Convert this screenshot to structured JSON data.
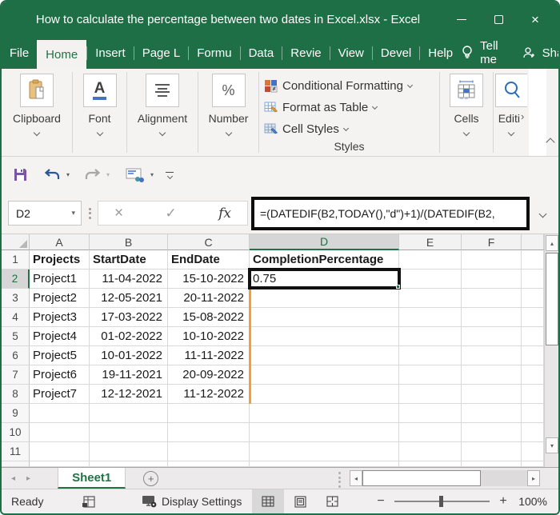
{
  "titlebar": {
    "title": "How to calculate the percentage between two dates in Excel.xlsx - Excel"
  },
  "menu": {
    "tabs": [
      {
        "label": "File",
        "active": false,
        "sep": false
      },
      {
        "label": "Home",
        "active": true,
        "sep": false
      },
      {
        "label": "Insert",
        "active": false,
        "sep": true
      },
      {
        "label": "Page L",
        "active": false,
        "sep": true
      },
      {
        "label": "Formu",
        "active": false,
        "sep": true
      },
      {
        "label": "Data",
        "active": false,
        "sep": true
      },
      {
        "label": "Revie",
        "active": false,
        "sep": true
      },
      {
        "label": "View",
        "active": false,
        "sep": true
      },
      {
        "label": "Devel",
        "active": false,
        "sep": true
      },
      {
        "label": "Help",
        "active": false,
        "sep": true
      }
    ],
    "tell_me": "Tell me",
    "share": "Share"
  },
  "ribbon": {
    "groups": [
      {
        "label": "Clipboard"
      },
      {
        "label": "Font"
      },
      {
        "label": "Alignment"
      },
      {
        "label": "Number"
      }
    ],
    "styles": {
      "items": [
        "Conditional Formatting",
        "Format as Table",
        "Cell Styles"
      ],
      "label": "Styles"
    },
    "cells": {
      "label": "Cells"
    },
    "editing": {
      "label": "Editi",
      "more_glyph": "›"
    }
  },
  "formula_bar": {
    "name_box": "D2",
    "cancel_glyph": "×",
    "enter_glyph": "✓",
    "fx_glyph": "fx",
    "formula": "=(DATEDIF(B2,TODAY(),\"d\")+1)/(DATEDIF(B2,"
  },
  "grid": {
    "column_headers": [
      "A",
      "B",
      "C",
      "D",
      "E",
      "F"
    ],
    "selected_column": "D",
    "selected_cell": "D2",
    "selected_row": 2,
    "rows": [
      {
        "n": 1,
        "cells": [
          "Projects",
          "StartDate",
          "EndDate",
          "CompletionPercentage"
        ],
        "header": true
      },
      {
        "n": 2,
        "cells": [
          "Project1",
          "11-04-2022",
          "15-10-2022",
          "0.75"
        ]
      },
      {
        "n": 3,
        "cells": [
          "Project2",
          "12-05-2021",
          "20-11-2022",
          ""
        ]
      },
      {
        "n": 4,
        "cells": [
          "Project3",
          "17-03-2022",
          "15-08-2022",
          ""
        ]
      },
      {
        "n": 5,
        "cells": [
          "Project4",
          "01-02-2022",
          "10-10-2022",
          ""
        ]
      },
      {
        "n": 6,
        "cells": [
          "Project5",
          "10-01-2022",
          "11-11-2022",
          ""
        ]
      },
      {
        "n": 7,
        "cells": [
          "Project6",
          "19-11-2021",
          "20-09-2022",
          ""
        ]
      },
      {
        "n": 8,
        "cells": [
          "Project7",
          "12-12-2021",
          "11-12-2022",
          ""
        ]
      },
      {
        "n": 9,
        "cells": [
          "",
          "",
          "",
          ""
        ]
      },
      {
        "n": 10,
        "cells": [
          "",
          "",
          "",
          ""
        ]
      },
      {
        "n": 11,
        "cells": [
          "",
          "",
          "",
          ""
        ]
      }
    ]
  },
  "sheet_bar": {
    "active_tab": "Sheet1",
    "add_glyph": "+"
  },
  "status_bar": {
    "mode": "Ready",
    "display_settings": "Display Settings",
    "zoom_level": "100%"
  },
  "colors": {
    "chrome_green": "#1e6e46",
    "accent_green": "#217346",
    "fill_indicator_orange": "#efa135",
    "annotation_black": "#111111",
    "undo_blue": "#2b579a",
    "save_purple": "#7a56a4"
  }
}
